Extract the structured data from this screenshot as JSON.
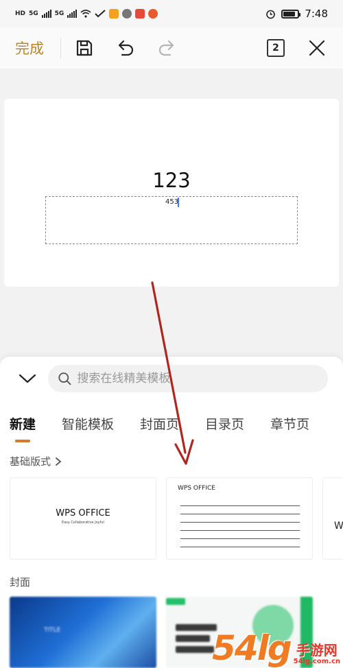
{
  "status_bar": {
    "left_chips": [
      "HD",
      "5G",
      "5G"
    ],
    "time": "7:48",
    "battery_level": 0.85
  },
  "toolbar": {
    "done_label": "完成",
    "page_count": "2",
    "icons": [
      "save-icon",
      "undo-icon",
      "redo-icon",
      "close-icon"
    ]
  },
  "document": {
    "title_text": "123",
    "textbox_text": "453"
  },
  "panel": {
    "search_placeholder": "搜索在线精美模板",
    "tabs": [
      {
        "label": "新建",
        "active": true
      },
      {
        "label": "智能模板",
        "active": false
      },
      {
        "label": "封面页",
        "active": false
      },
      {
        "label": "目录页",
        "active": false
      },
      {
        "label": "章节页",
        "active": false
      }
    ],
    "section_basic": "基础版式",
    "section_cover": "封面",
    "templates": [
      {
        "title": "WPS OFFICE",
        "subtitle": "Easy Collaborative Joyful"
      },
      {
        "title": "WPS OFFICE"
      },
      {
        "letter": "W"
      }
    ],
    "cover_blue_title": "TITLE"
  },
  "watermark": {
    "big": "54lg",
    "cn": "手游网",
    "url": "54lg.com.cn"
  },
  "colors": {
    "accent": "#b8862f",
    "tab_underline": "#d47a2a",
    "arrow": "#b0261e",
    "cursor": "#2f7df6"
  }
}
